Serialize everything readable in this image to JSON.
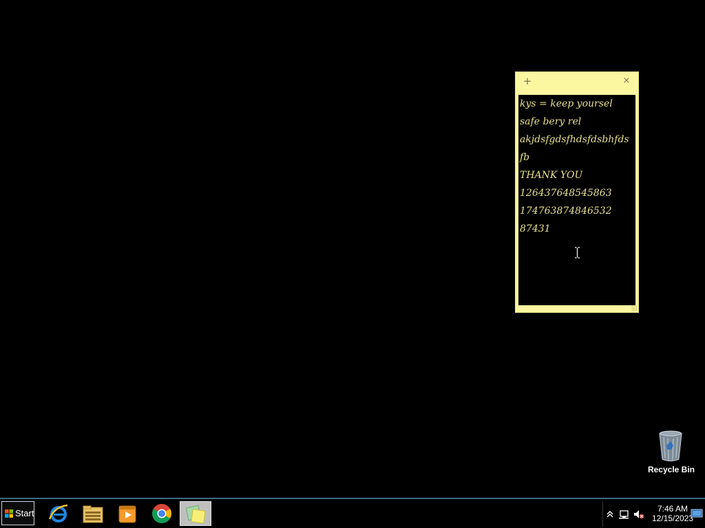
{
  "sticky_note": {
    "add_symbol": "+",
    "close_symbol": "×",
    "lines": [
      "kys = keep yoursel",
      "safe bery rel",
      "akjdsfgdsfhdsfdsbhfds",
      "fb",
      "THANK YOU",
      "126437648545863",
      "174763874846532",
      "87431"
    ],
    "colors": {
      "note": "#fbf7a1",
      "body": "#000000",
      "text": "#e7e18a"
    }
  },
  "desktop": {
    "recycle_bin": {
      "label": "Recycle Bin",
      "icon": "recycle-bin-icon"
    }
  },
  "taskbar": {
    "start_label": "Start",
    "pinned": [
      {
        "name": "internet-explorer",
        "icon": "internet-explorer-icon"
      },
      {
        "name": "file-explorer",
        "icon": "folder-icon"
      },
      {
        "name": "media-player",
        "icon": "media-player-icon"
      },
      {
        "name": "chrome",
        "icon": "chrome-icon"
      },
      {
        "name": "sticky-notes",
        "icon": "sticky-notes-icon",
        "active": true
      }
    ],
    "tray": {
      "icons": [
        "show-hidden-icons-chevron",
        "network-icon",
        "volume-muted-icon"
      ],
      "time": "7:46 AM",
      "date": "12/15/2023"
    }
  },
  "accent_color": "#3c6e7e"
}
